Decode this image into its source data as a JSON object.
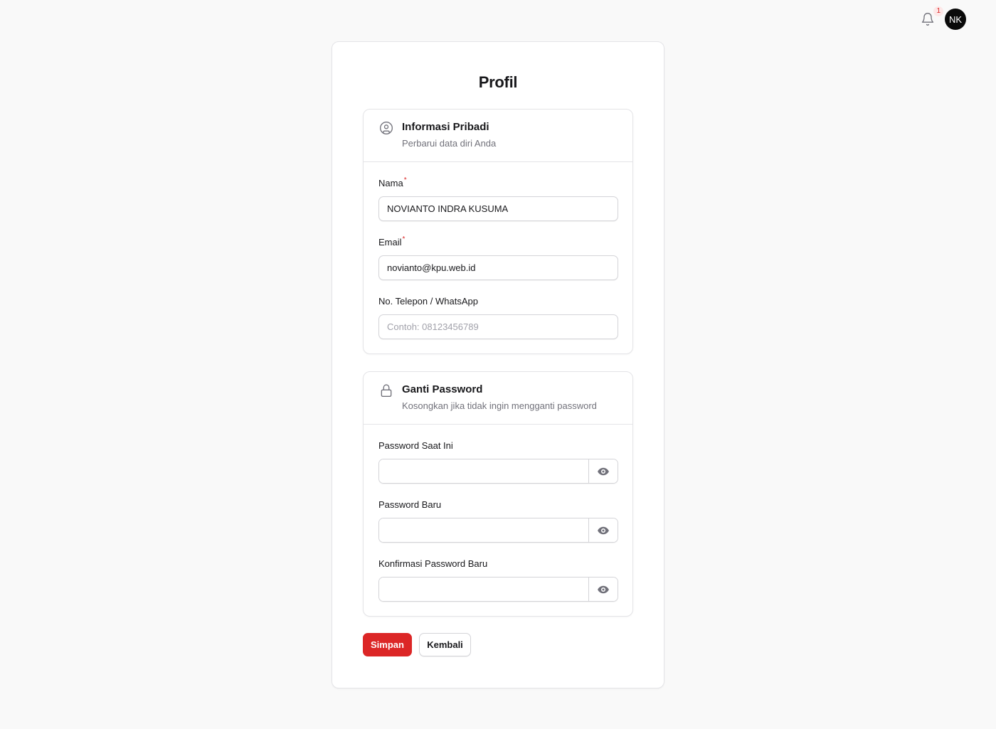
{
  "header": {
    "notification_count": "1",
    "avatar_initials": "NK"
  },
  "page": {
    "title": "Profil"
  },
  "personal_info": {
    "title": "Informasi Pribadi",
    "description": "Perbarui data diri Anda",
    "icon": "user-circle-icon",
    "fields": {
      "name": {
        "label": "Nama",
        "required_mark": "*",
        "value": "NOVIANTO INDRA KUSUMA"
      },
      "email": {
        "label": "Email",
        "required_mark": "*",
        "value": "novianto@kpu.web.id"
      },
      "phone": {
        "label": "No. Telepon / WhatsApp",
        "value": "",
        "placeholder": "Contoh: 08123456789"
      }
    }
  },
  "password_section": {
    "title": "Ganti Password",
    "description": "Kosongkan jika tidak ingin mengganti password",
    "icon": "lock-icon",
    "fields": {
      "current": {
        "label": "Password Saat Ini",
        "value": ""
      },
      "new": {
        "label": "Password Baru",
        "value": ""
      },
      "confirm": {
        "label": "Konfirmasi Password Baru",
        "value": ""
      }
    }
  },
  "actions": {
    "save_label": "Simpan",
    "back_label": "Kembali"
  },
  "colors": {
    "primary": "#dc2626",
    "avatar_bg": "#0a0a0a",
    "border": "#e4e4e7",
    "muted_text": "#71717a"
  }
}
